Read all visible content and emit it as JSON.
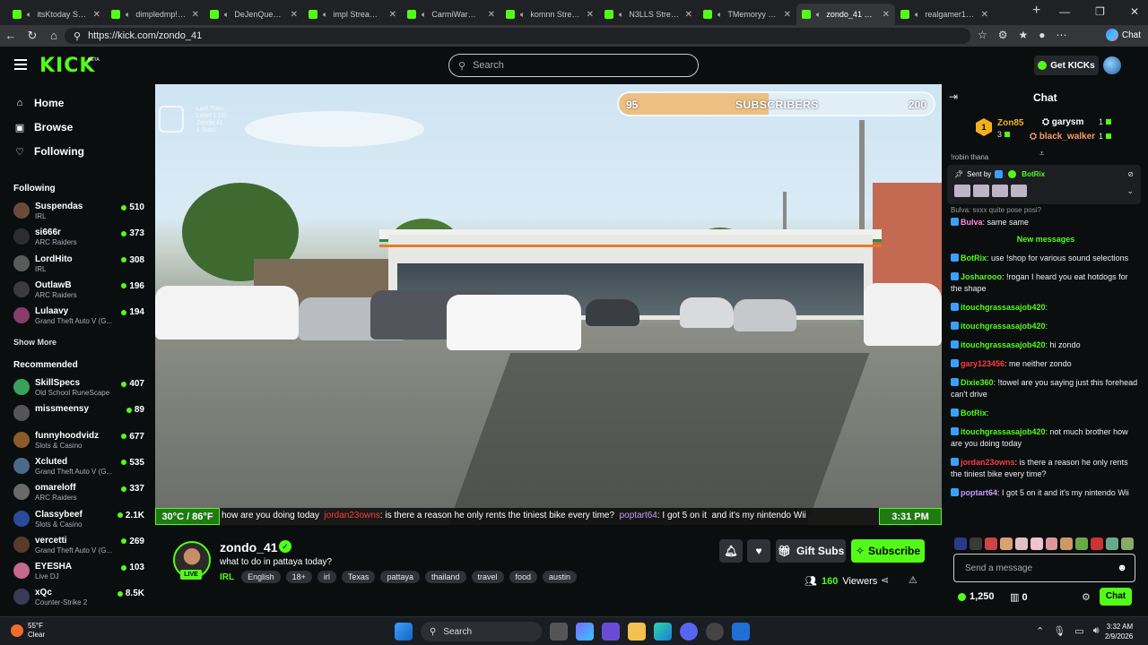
{
  "browser": {
    "tabs": [
      {
        "title": "itsKtoday Stream",
        "active": false
      },
      {
        "title": "dimpledmp!ng",
        "active": false
      },
      {
        "title": "DeJenQueen Str",
        "active": false
      },
      {
        "title": "impl Stream - V",
        "active": false
      },
      {
        "title": "CarmiWarmy Str",
        "active": false
      },
      {
        "title": "komnn Stream",
        "active": false
      },
      {
        "title": "N3LLS Stream -",
        "active": false
      },
      {
        "title": "TMemoryy Strea",
        "active": false
      },
      {
        "title": "zondo_41 Strea",
        "active": true
      },
      {
        "title": "realgamer1985 -",
        "active": false
      }
    ],
    "url": "https://kick.com/zondo_41",
    "copilot_label": "Chat"
  },
  "header": {
    "logo": "KICK",
    "beta": "BETA",
    "search_placeholder": "Search",
    "get_kicks": "Get KICKs"
  },
  "sidebar": {
    "nav": [
      {
        "label": "Home",
        "icon": "home-icon"
      },
      {
        "label": "Browse",
        "icon": "browse-icon"
      },
      {
        "label": "Following",
        "icon": "heart-icon"
      }
    ],
    "following_title": "Following",
    "following": [
      {
        "name": "Suspendas",
        "category": "IRL",
        "viewers": "510"
      },
      {
        "name": "si666r",
        "category": "ARC Raiders",
        "viewers": "373"
      },
      {
        "name": "LordHito",
        "category": "IRL",
        "viewers": "308"
      },
      {
        "name": "OutlawB",
        "category": "ARC Raiders",
        "viewers": "196"
      },
      {
        "name": "Lulaavy",
        "category": "Grand Theft Auto V (G...",
        "viewers": "194"
      }
    ],
    "show_more": "Show More",
    "recommended_title": "Recommended",
    "recommended": [
      {
        "name": "SkillSpecs",
        "category": "Old School RuneScape",
        "viewers": "407"
      },
      {
        "name": "missmeensy",
        "category": "",
        "viewers": "89"
      },
      {
        "name": "funnyhoodvidz",
        "category": "Slots & Casino",
        "viewers": "677"
      },
      {
        "name": "Xcluted",
        "category": "Grand Theft Auto V (G...",
        "viewers": "535"
      },
      {
        "name": "omareloff",
        "category": "ARC Raiders",
        "viewers": "337"
      },
      {
        "name": "Classybeef",
        "category": "Slots & Casino",
        "viewers": "2.1K"
      },
      {
        "name": "vercetti",
        "category": "Grand Theft Auto V (G...",
        "viewers": "269"
      },
      {
        "name": "EYESHA",
        "category": "Live DJ",
        "viewers": "103"
      },
      {
        "name": "xQc",
        "category": "Counter-Strike 2",
        "viewers": "8.5K"
      }
    ]
  },
  "video": {
    "train_info": "Last Train\nLevel 1 (3)\nZondo 41\n1 Subs",
    "sub_goal": {
      "current": "95",
      "target": "200",
      "label": "SUBSCRIBERS",
      "progress": 0.475
    },
    "temperature": "30°C / 86°F",
    "clock": "3:31 PM",
    "ticker": {
      "pre": "how are you doing today",
      "user1": "jordan23owns",
      "text1": ": is there a reason he only rents the tiniest bike every time?",
      "user2": "poptart64",
      "text2": ": I got 5 on it",
      "text3": "and it's my nintendo Wii"
    }
  },
  "stream": {
    "name": "zondo_41",
    "title": "what to do in pattaya today?",
    "live": "LIVE",
    "category": "IRL",
    "tags": [
      "English",
      "18+",
      "irl",
      "Texas",
      "pattaya",
      "thailand",
      "travel",
      "food",
      "austin"
    ],
    "gift_subs": "Gift Subs",
    "subscribe": "Subscribe",
    "viewers": "160",
    "viewers_label": "Viewers"
  },
  "chat": {
    "title": "Chat",
    "leaderboard": {
      "rank1": "1",
      "top_name": "Zon85",
      "top_count": "3",
      "second_name": "garysm",
      "second_count": "1",
      "third_name": "black_walker",
      "third_count": "1"
    },
    "cut_text": "!robin thana",
    "pinned_label": "Sent by",
    "pinned_user": "BotRix",
    "above_msg": "Bulva: sxxx quite pose posi?",
    "messages_before": [
      {
        "user": "Bulva",
        "color": "#ff8bd8",
        "text": ": same same"
      }
    ],
    "new_messages": "New messages",
    "messages": [
      {
        "user": "BotRix",
        "color": "#53fc18",
        "text": ": use !shop for various sound selections"
      },
      {
        "user": "Josharooo",
        "color": "#53fc18",
        "text": ": !rogan I heard you eat hotdogs for the shape"
      },
      {
        "user": "itouchgrassasajob420",
        "color": "#53fc18",
        "text": ":"
      },
      {
        "user": "itouchgrassasajob420",
        "color": "#53fc18",
        "text": ":"
      },
      {
        "user": "itouchgrassasajob420",
        "color": "#53fc18",
        "text": ": hi zondo"
      },
      {
        "user": "gary123456",
        "color": "#ff3b3b",
        "text": ": me neither zondo"
      },
      {
        "user": "Dixie360",
        "color": "#53fc18",
        "text": ": !towel are you saying just this forehead can't drive"
      },
      {
        "user": "BotRix",
        "color": "#53fc18",
        "text": ":"
      },
      {
        "user": "itouchgrassasajob420",
        "color": "#53fc18",
        "text": ": not much brother how are you doing today"
      },
      {
        "user": "jordan23owns",
        "color": "#ff3b3b",
        "text": ": is there a reason he only rents the tiniest bike every time?"
      },
      {
        "user": "poptart64",
        "color": "#c89bff",
        "text": ": I got 5 on it   and it's my nintendo Wii"
      }
    ],
    "input_placeholder": "Send a message",
    "points": "1,250",
    "kicks": "0",
    "send": "Chat"
  },
  "taskbar": {
    "temp": "55°F",
    "weather": "Clear",
    "search": "Search",
    "time": "3:32 AM",
    "date": "2/9/2026"
  }
}
